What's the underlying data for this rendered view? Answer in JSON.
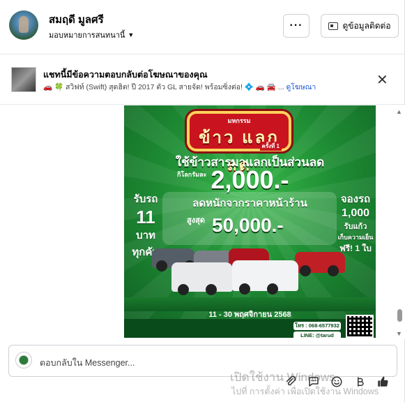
{
  "header": {
    "name": "สมฤดี มูลศรี",
    "status": "มอบหมายการสนทนานี้",
    "more_label": "···",
    "contact_label": "ดูข้อมูลติดต่อ"
  },
  "ad": {
    "title": "แชทนี้มีข้อความตอบกลับต่อโฆษณาของคุณ",
    "subtitle": "🚗 🍀 สวิฟท์ (Swift) สุดฮิต! ปี 2017 ตัว GL สายจัด! พร้อมซิ่งต่อ! 💠 🚗 🚘 ...",
    "link": "ดูโฆษณา"
  },
  "poster": {
    "sign_top": "มหกรรม",
    "sign_main": "ข้าว แลก ลด",
    "sign_sub": "ครั้งที่ 1",
    "headline": "ใช้ข้าวสารมาแลกเป็นส่วนลด",
    "per_kg": "กิโลกรัมละ",
    "price": "2,000.-",
    "subline": "ลดหนักจากราคาหน้าร้าน",
    "max_label": "สูงสุด",
    "max_value": "50,000.-",
    "left_1": "รับรถ",
    "left_2": "11",
    "left_3": "บาท",
    "left_4": "ทุกคัน",
    "right_1": "จองรถ",
    "right_2": "1,000",
    "right_3": "รับแก้ว",
    "right_4": "เก็บความเย็น",
    "right_5": "ฟรี! 1 ใบ",
    "dates": "11 - 30 พฤศจิกายน 2568",
    "tel": "โทร : 068-6577932",
    "line": "LINE: @tarud"
  },
  "composer": {
    "placeholder": "ตอบกลับใน Messenger..."
  },
  "watermark": {
    "line1": "เปิดใช้งาน Windows",
    "line2": "ไปที่ การตั้งค่า เพื่อเปิดใช้งาน Windows"
  }
}
